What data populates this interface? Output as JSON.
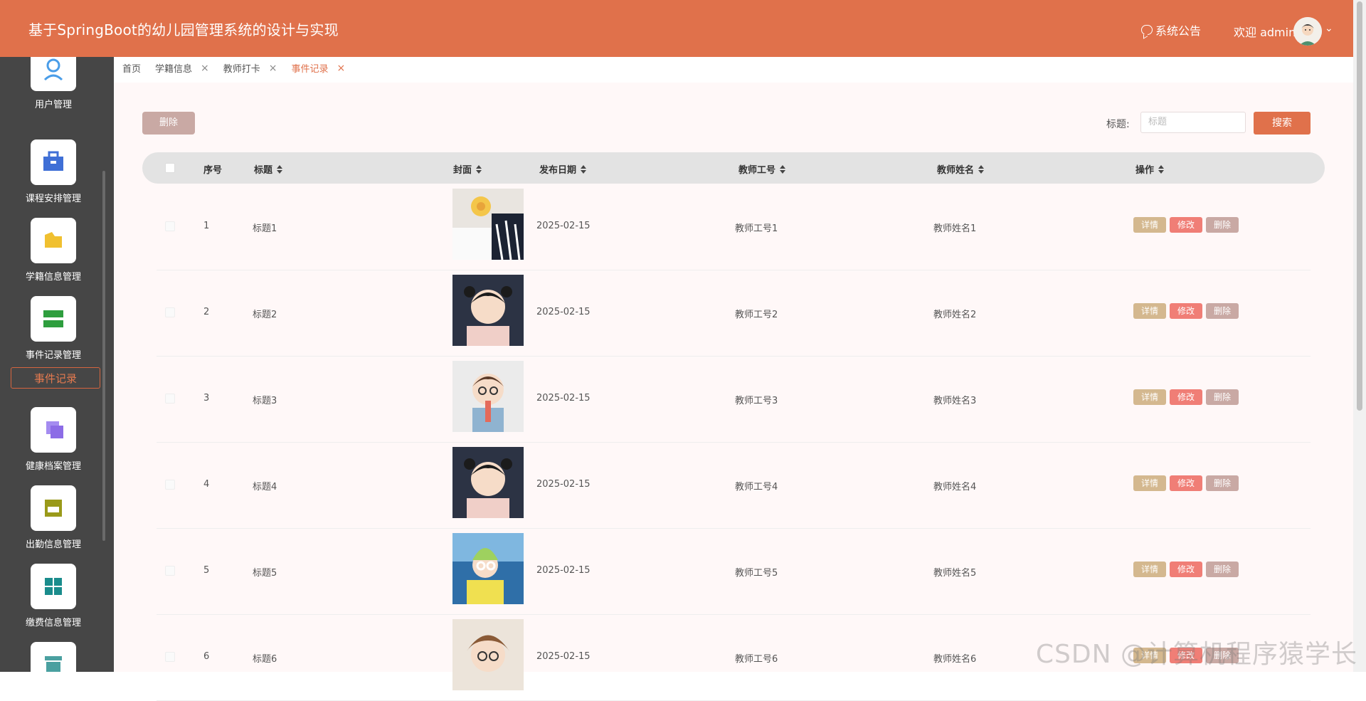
{
  "header": {
    "title": "基于SpringBoot的幼儿园管理系统的设计与实现",
    "notice_label": "系统公告",
    "welcome": "欢迎 admin",
    "brand_color": "#e0714b"
  },
  "sidebar": {
    "items": [
      {
        "label": "用户管理",
        "icon": "user-icon",
        "color": "#4a9de8"
      },
      {
        "label": "课程安排管理",
        "icon": "course-icon",
        "color": "#3f6fd6"
      },
      {
        "label": "学籍信息管理",
        "icon": "folder-icon",
        "color": "#f0c030"
      },
      {
        "label": "事件记录管理",
        "icon": "event-icon",
        "color": "#2e9e3e"
      },
      {
        "label": "健康档案管理",
        "icon": "health-icon",
        "color": "#8c6ce6"
      },
      {
        "label": "出勤信息管理",
        "icon": "attendance-icon",
        "color": "#9a9a1a"
      },
      {
        "label": "缴费信息管理",
        "icon": "payment-icon",
        "color": "#1a8c8c"
      },
      {
        "label": "",
        "icon": "archive-icon",
        "color": "#4aa0a0"
      }
    ],
    "active_submenu": "事件记录"
  },
  "tabs": [
    {
      "label": "首页",
      "closable": false
    },
    {
      "label": "学籍信息",
      "closable": true
    },
    {
      "label": "教师打卡",
      "closable": true
    },
    {
      "label": "事件记录",
      "closable": true,
      "active": true
    }
  ],
  "toolbar": {
    "delete_label": "删除",
    "search_label": "标题:",
    "search_placeholder": "标题",
    "search_button": "搜索"
  },
  "table": {
    "headers": [
      "序号",
      "标题",
      "封面",
      "发布日期",
      "教师工号",
      "教师姓名",
      "操作"
    ],
    "actions": {
      "detail": "详情",
      "edit": "修改",
      "delete": "删除"
    },
    "rows": [
      {
        "no": "1",
        "title": "标题1",
        "date": "2025-02-15",
        "teacher_id": "教师工号1",
        "teacher_name": "教师姓名1"
      },
      {
        "no": "2",
        "title": "标题2",
        "date": "2025-02-15",
        "teacher_id": "教师工号2",
        "teacher_name": "教师姓名2"
      },
      {
        "no": "3",
        "title": "标题3",
        "date": "2025-02-15",
        "teacher_id": "教师工号3",
        "teacher_name": "教师姓名3"
      },
      {
        "no": "4",
        "title": "标题4",
        "date": "2025-02-15",
        "teacher_id": "教师工号4",
        "teacher_name": "教师姓名4"
      },
      {
        "no": "5",
        "title": "标题5",
        "date": "2025-02-15",
        "teacher_id": "教师工号5",
        "teacher_name": "教师姓名5"
      },
      {
        "no": "6",
        "title": "标题6",
        "date": "2025-02-15",
        "teacher_id": "教师工号6",
        "teacher_name": "教师姓名6"
      }
    ]
  },
  "watermark": "CSDN @计算机程序猿学长"
}
